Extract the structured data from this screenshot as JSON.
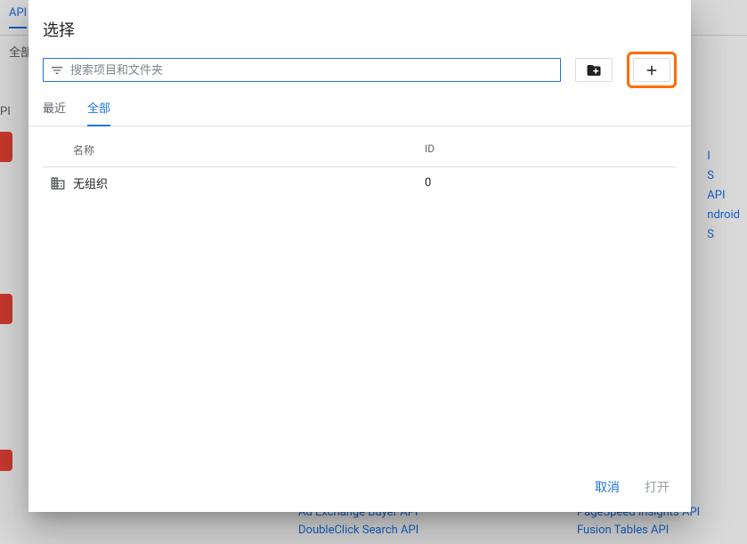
{
  "bg": {
    "topbar_link": "API",
    "filter_label": "全部",
    "side_label": "PI",
    "right_links": [
      "I",
      "S",
      "API",
      "ndroid",
      "S"
    ],
    "bottom_left": [
      "Ad Exchange Buyer API",
      "DoubleClick Search API"
    ],
    "bottom_right": [
      "PageSpeed Insights API",
      "Fusion Tables API"
    ]
  },
  "modal": {
    "title": "选择",
    "search_placeholder": "搜索项目和文件夹",
    "tabs": {
      "recent": "最近",
      "all": "全部"
    },
    "columns": {
      "name": "名称",
      "id": "ID"
    },
    "rows": [
      {
        "name": "无组织",
        "id": "0"
      }
    ],
    "footer": {
      "cancel": "取消",
      "open": "打开"
    }
  }
}
